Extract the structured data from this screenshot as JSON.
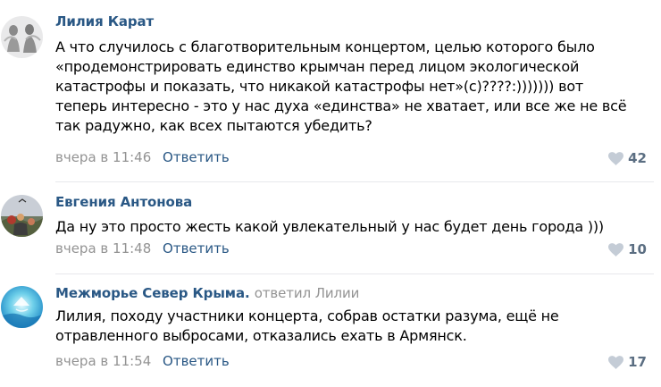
{
  "comments": [
    {
      "author": "Лилия Карат",
      "reply_to": "",
      "text": "А что случилось с благотворительным концертом, целью которого было\n«продемонстрировать единство крымчан перед лицом экологической\nкатастрофы и показать, что никакой катастрофы нет»(с)????:))))))) вот\nтеперь интересно - это у нас духа «единства» не хватает, или все же не всё\nтак радужно, как всех пытаются убедить?",
      "time": "вчера в 11:46",
      "reply_label": "Ответить",
      "likes": "42",
      "avatar_icon": "avatar-photo-icon"
    },
    {
      "author": "Евгения Антонова",
      "reply_to": "",
      "text": "Да ну это просто жесть какой увлекательный у нас будет день города )))",
      "time": "вчера в 11:48",
      "reply_label": "Ответить",
      "likes": "10",
      "avatar_icon": "avatar-photo-icon"
    },
    {
      "author": "Межморье Север Крыма.",
      "reply_to": "ответил Лилии",
      "text": "Лилия, походу участники концерта, собрав остатки разума, ещё не\nотравленного выбросами, отказались ехать в Армянск.",
      "time": "вчера в 11:54",
      "reply_label": "Ответить",
      "likes": "17",
      "avatar_icon": "avatar-photo-icon"
    }
  ],
  "colors": {
    "link": "#2a5885",
    "meta": "#939393",
    "like": "#5b6e82",
    "divider": "#e7e8ec"
  }
}
